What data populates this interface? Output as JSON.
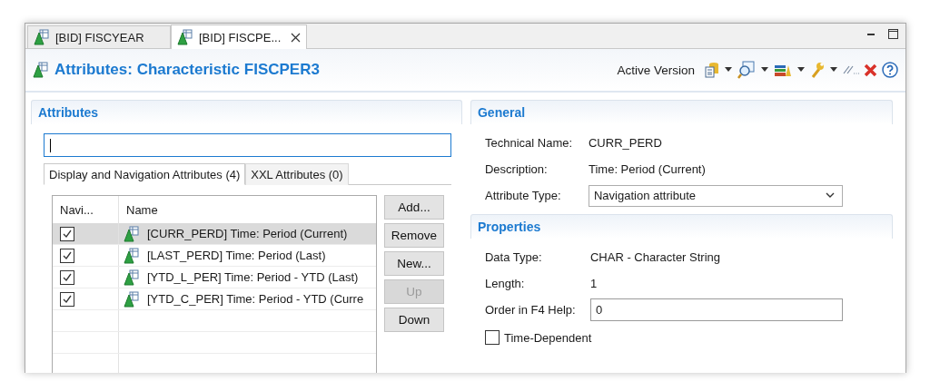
{
  "editor_tabs": [
    {
      "label": "[BID] FISCYEAR",
      "selected": false
    },
    {
      "label": "[BID] FISCPE...",
      "selected": true
    }
  ],
  "header": {
    "title": "Attributes: Characteristic FISCPER3",
    "version": "Active Version"
  },
  "attributes": {
    "title": "Attributes",
    "subtabs": [
      {
        "label": "Display and Navigation Attributes (4)",
        "selected": true
      },
      {
        "label": "XXL Attributes (0)",
        "selected": false
      }
    ],
    "columns": [
      "Navi...",
      "Name"
    ],
    "rows": [
      {
        "checked": true,
        "name": "[CURR_PERD] Time: Period (Current)",
        "selected": true
      },
      {
        "checked": true,
        "name": "[LAST_PERD] Time: Period (Last)",
        "selected": false
      },
      {
        "checked": true,
        "name": "[YTD_L_PER] Time: Period - YTD (Last)",
        "selected": false
      },
      {
        "checked": true,
        "name": "[YTD_C_PER] Time: Period - YTD (Curre",
        "selected": false
      }
    ],
    "buttons": [
      {
        "label": "Add...",
        "disabled": false
      },
      {
        "label": "Remove",
        "disabled": false
      },
      {
        "label": "New...",
        "disabled": false
      },
      {
        "label": "Up",
        "disabled": true
      },
      {
        "label": "Down",
        "disabled": false
      }
    ]
  },
  "general": {
    "title": "General",
    "fields": [
      {
        "kind": "text",
        "label": "Technical Name:",
        "value": "CURR_PERD"
      },
      {
        "kind": "text",
        "label": "Description:",
        "value": "Time: Period (Current)"
      },
      {
        "kind": "select",
        "label": "Attribute Type:",
        "value": "Navigation attribute"
      }
    ]
  },
  "properties": {
    "title": "Properties",
    "fields": [
      {
        "kind": "text",
        "label": "Data Type:",
        "value": "CHAR - Character String"
      },
      {
        "kind": "text",
        "label": "Length:",
        "value": "1"
      },
      {
        "kind": "input",
        "label": "Order in F4 Help:",
        "value": "0"
      },
      {
        "kind": "checkbox",
        "label": "Time-Dependent",
        "checked": false
      }
    ]
  }
}
